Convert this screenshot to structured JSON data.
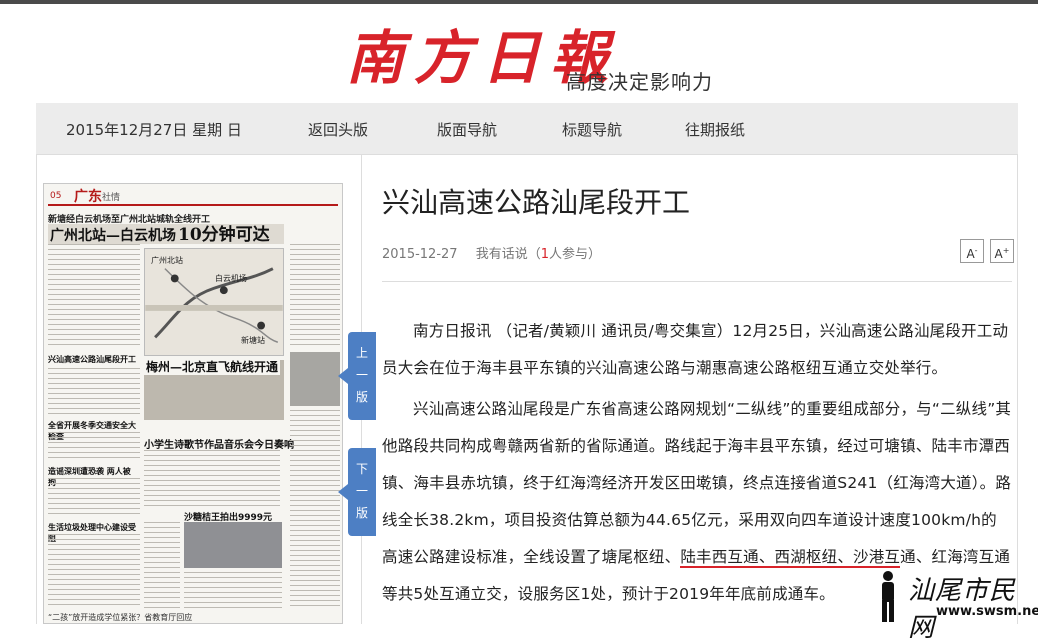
{
  "masthead": {
    "logo": "南方日報",
    "slogan": "高度决定影响力"
  },
  "nav": {
    "date": "2015年12月27日 星期 日",
    "items": [
      "返回头版",
      "版面导航",
      "标题导航",
      "往期报纸"
    ]
  },
  "page_thumbnail": {
    "page_number": "05",
    "section": "广东",
    "subsection": "社情",
    "headline_small": "新塘经白云机场至广州北站城轨全线开工",
    "headline_main_a": "广州北站—白云机场",
    "headline_main_b": "10分钟可达",
    "map_labels": [
      "广州北站",
      "白云机场",
      "新塘站"
    ],
    "story2": "梅州—北京直飞航线开通",
    "story3": "小学生诗歌节作品音乐会今日奏响",
    "story4": "沙糖桔王拍出9999元",
    "side_items": [
      "兴汕高速公路汕尾段开工",
      "全省开展冬季交通安全大检查",
      "造谣深圳遭恐袭 两人被拘",
      "生活垃圾处理中心建设受阻"
    ],
    "footer": "“二孩”放开造成学位紧张？省教育厅回应"
  },
  "page_buttons": {
    "prev": "上一版",
    "next": "下一版"
  },
  "article": {
    "title": "兴汕高速公路汕尾段开工",
    "date": "2015-12-27",
    "comment_prefix": "我有话说（",
    "comment_count": "1",
    "comment_suffix": "人参与）",
    "font_decrease": "A",
    "font_increase": "A",
    "paragraph1": "南方日报讯 （记者/黄颖川 通讯员/粤交集宣）12月25日，兴汕高速公路汕尾段开工动员大会在位于海丰县平东镇的兴汕高速公路与潮惠高速公路枢纽互通立交处举行。",
    "paragraph2_before": "兴汕高速公路汕尾段是广东省高速公路网规划“二纵线”的重要组成部分，与“二纵线”其他路段共同构成粤赣两省新的省际通道。路线起于海丰县平东镇，经过可塘镇、陆丰市潭西镇、海丰县赤坑镇，终于红海湾经济开发区田墘镇，终点连接省道S241（红海湾大道）。路线全长38.2km，项目投资估算总额为44.65亿元，采用双向四车道设计速度100km/h的高速公路建设标准，全线设置了塘尾枢纽、",
    "paragraph2_highlight": "陆丰西互通、西湖枢纽、沙港互",
    "paragraph2_after": "通、红海湾互通等共5处互通立交，设服务区1处，预计于2019年年底前",
    "paragraph2_end": "成通车。"
  },
  "watermark": {
    "text": "汕尾市民网",
    "url": "www.swsm.net"
  }
}
